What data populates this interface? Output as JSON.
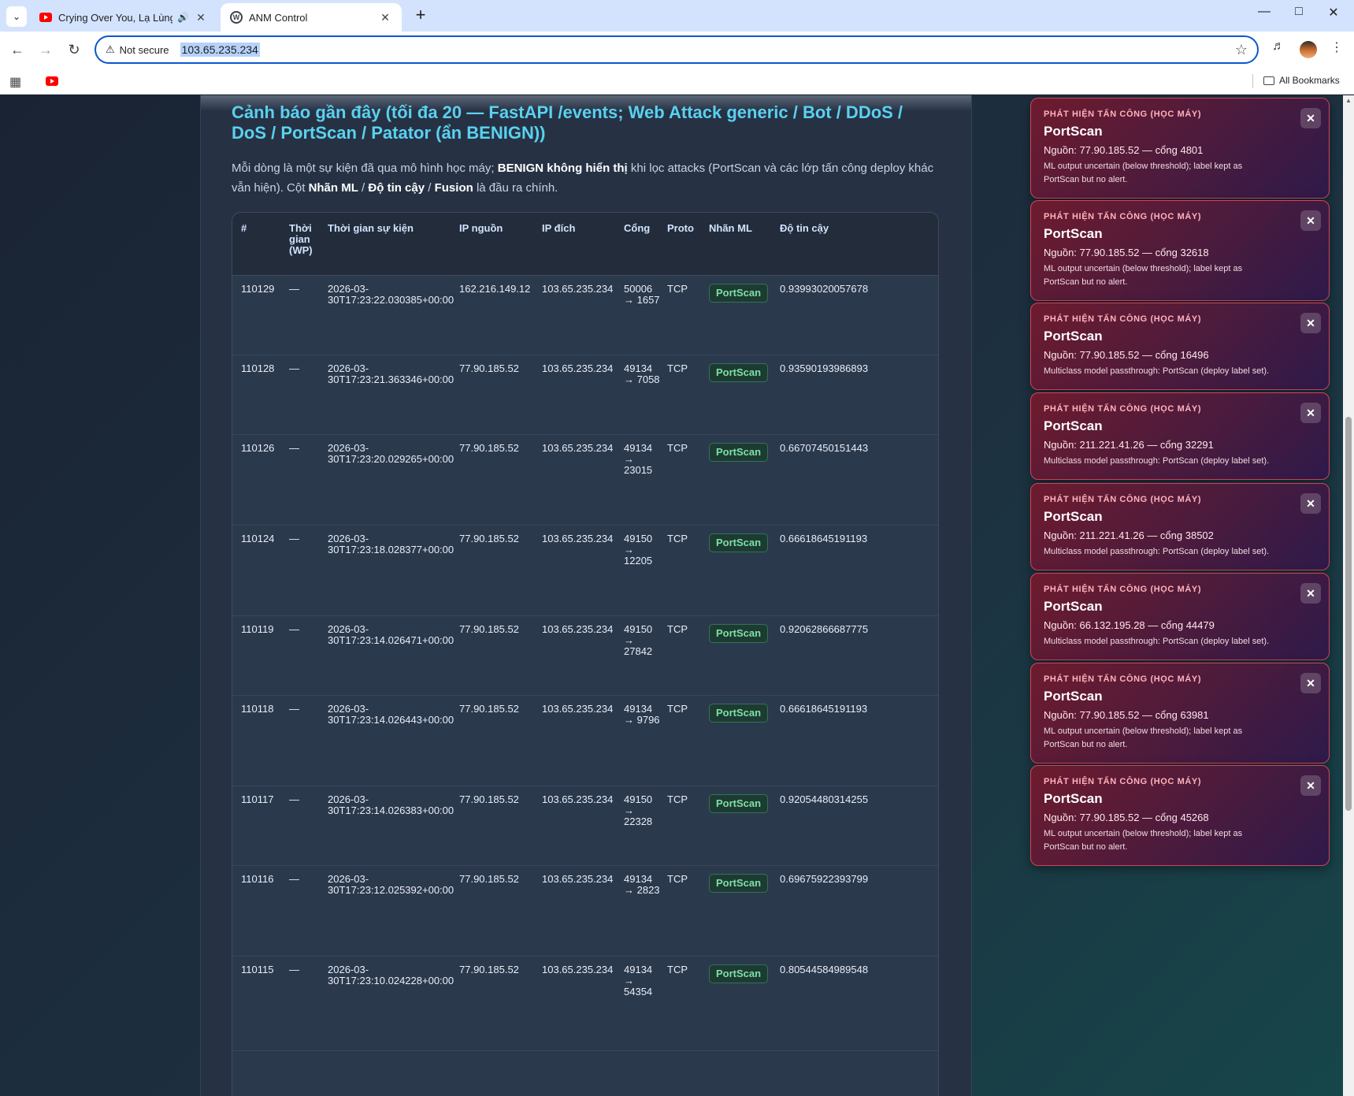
{
  "browser": {
    "tabs": [
      {
        "title": "Crying Over You, Lạ Lùng, M",
        "favicon": "youtube-icon",
        "audio": true
      },
      {
        "title": "ANM Control",
        "favicon": "wordpress-icon",
        "active": true
      }
    ],
    "omnibox": {
      "security": "Not secure",
      "url": "103.65.235.234"
    },
    "bookmarks": {
      "all_label": "All Bookmarks"
    }
  },
  "page": {
    "heading": "Cảnh báo gần đây (tối đa 20 — FastAPI /events; Web Attack generic / Bot / DDoS / DoS / PortScan / Patator (ẩn BENIGN))",
    "desc": {
      "p1": "Mỗi dòng là một sự kiện đã qua mô hình học máy; ",
      "b1": "BENIGN không hiển thị",
      "p2": " khi lọc attacks (PortScan và các lớp tấn công deploy khác vẫn hiện). Cột ",
      "b2": "Nhãn ML",
      "p3": " / ",
      "b3": "Độ tin cậy",
      "p4": " / ",
      "b4": "Fusion",
      "p5": " là đầu ra chính."
    },
    "table": {
      "headers": [
        "#",
        "Thời gian (WP)",
        "Thời gian sự kiện",
        "IP nguồn",
        "IP đích",
        "Cổng",
        "Proto",
        "Nhãn ML",
        "Độ tin cậy"
      ],
      "rows": [
        {
          "id": "110129",
          "wp": "—",
          "time": "2026-03-30T17:23:22.030385+00:00",
          "src": "162.216.149.12",
          "dst": "103.65.235.234",
          "port": "50006 → 1657",
          "proto": "TCP",
          "label": "PortScan",
          "conf": "0.93993020057678"
        },
        {
          "id": "110128",
          "wp": "—",
          "time": "2026-03-30T17:23:21.363346+00:00",
          "src": "77.90.185.52",
          "dst": "103.65.235.234",
          "port": "49134 → 7058",
          "proto": "TCP",
          "label": "PortScan",
          "conf": "0.93590193986893"
        },
        {
          "id": "110126",
          "wp": "—",
          "time": "2026-03-30T17:23:20.029265+00:00",
          "src": "77.90.185.52",
          "dst": "103.65.235.234",
          "port": "49134 → 23015",
          "proto": "TCP",
          "label": "PortScan",
          "conf": "0.66707450151443"
        },
        {
          "id": "110124",
          "wp": "—",
          "time": "2026-03-30T17:23:18.028377+00:00",
          "src": "77.90.185.52",
          "dst": "103.65.235.234",
          "port": "49150 → 12205",
          "proto": "TCP",
          "label": "PortScan",
          "conf": "0.66618645191193"
        },
        {
          "id": "110119",
          "wp": "—",
          "time": "2026-03-30T17:23:14.026471+00:00",
          "src": "77.90.185.52",
          "dst": "103.65.235.234",
          "port": "49150 → 27842",
          "proto": "TCP",
          "label": "PortScan",
          "conf": "0.92062866687775"
        },
        {
          "id": "110118",
          "wp": "—",
          "time": "2026-03-30T17:23:14.026443+00:00",
          "src": "77.90.185.52",
          "dst": "103.65.235.234",
          "port": "49134 → 9796",
          "proto": "TCP",
          "label": "PortScan",
          "conf": "0.66618645191193"
        },
        {
          "id": "110117",
          "wp": "—",
          "time": "2026-03-30T17:23:14.026383+00:00",
          "src": "77.90.185.52",
          "dst": "103.65.235.234",
          "port": "49150 → 22328",
          "proto": "TCP",
          "label": "PortScan",
          "conf": "0.92054480314255"
        },
        {
          "id": "110116",
          "wp": "—",
          "time": "2026-03-30T17:23:12.025392+00:00",
          "src": "77.90.185.52",
          "dst": "103.65.235.234",
          "port": "49134 → 2823",
          "proto": "TCP",
          "label": "PortScan",
          "conf": "0.69675922393799"
        },
        {
          "id": "110115",
          "wp": "—",
          "time": "2026-03-30T17:23:10.024228+00:00",
          "src": "77.90.185.52",
          "dst": "103.65.235.234",
          "port": "49134 → 54354",
          "proto": "TCP",
          "label": "PortScan",
          "conf": "0.80544584989548"
        }
      ]
    }
  },
  "toasts": [
    {
      "kicker": "PHÁT HIỆN TẤN CÔNG (HỌC MÁY)",
      "label": "PortScan",
      "source": "Nguồn: 77.90.185.52 — cổng 4801",
      "note": "ML output uncertain (below threshold); label kept as PortScan but no alert."
    },
    {
      "kicker": "PHÁT HIỆN TẤN CÔNG (HỌC MÁY)",
      "label": "PortScan",
      "source": "Nguồn: 77.90.185.52 — cổng 32618",
      "note": "ML output uncertain (below threshold); label kept as PortScan but no alert."
    },
    {
      "kicker": "PHÁT HIỆN TẤN CÔNG (HỌC MÁY)",
      "label": "PortScan",
      "source": "Nguồn: 77.90.185.52 — cổng 16496",
      "note": "Multiclass model passthrough: PortScan (deploy label set)."
    },
    {
      "kicker": "PHÁT HIỆN TẤN CÔNG (HỌC MÁY)",
      "label": "PortScan",
      "source": "Nguồn: 211.221.41.26 — cổng 32291",
      "note": "Multiclass model passthrough: PortScan (deploy label set)."
    },
    {
      "kicker": "PHÁT HIỆN TẤN CÔNG (HỌC MÁY)",
      "label": "PortScan",
      "source": "Nguồn: 211.221.41.26 — cổng 38502",
      "note": "Multiclass model passthrough: PortScan (deploy label set)."
    },
    {
      "kicker": "PHÁT HIỆN TẤN CÔNG (HỌC MÁY)",
      "label": "PortScan",
      "source": "Nguồn: 66.132.195.28 — cổng 44479",
      "note": "Multiclass model passthrough: PortScan (deploy label set)."
    },
    {
      "kicker": "PHÁT HIỆN TẤN CÔNG (HỌC MÁY)",
      "label": "PortScan",
      "source": "Nguồn: 77.90.185.52 — cổng 63981",
      "note": "ML output uncertain (below threshold); label kept as PortScan but no alert."
    },
    {
      "kicker": "PHÁT HIỆN TẤN CÔNG (HỌC MÁY)",
      "label": "PortScan",
      "source": "Nguồn: 77.90.185.52 — cổng 45268",
      "note": "ML output uncertain (below threshold); label kept as PortScan but no alert."
    }
  ],
  "icons": {
    "close": "close-icon",
    "reload": "reload-icon",
    "back": "back-arrow-icon",
    "forward": "forward-arrow-icon"
  }
}
